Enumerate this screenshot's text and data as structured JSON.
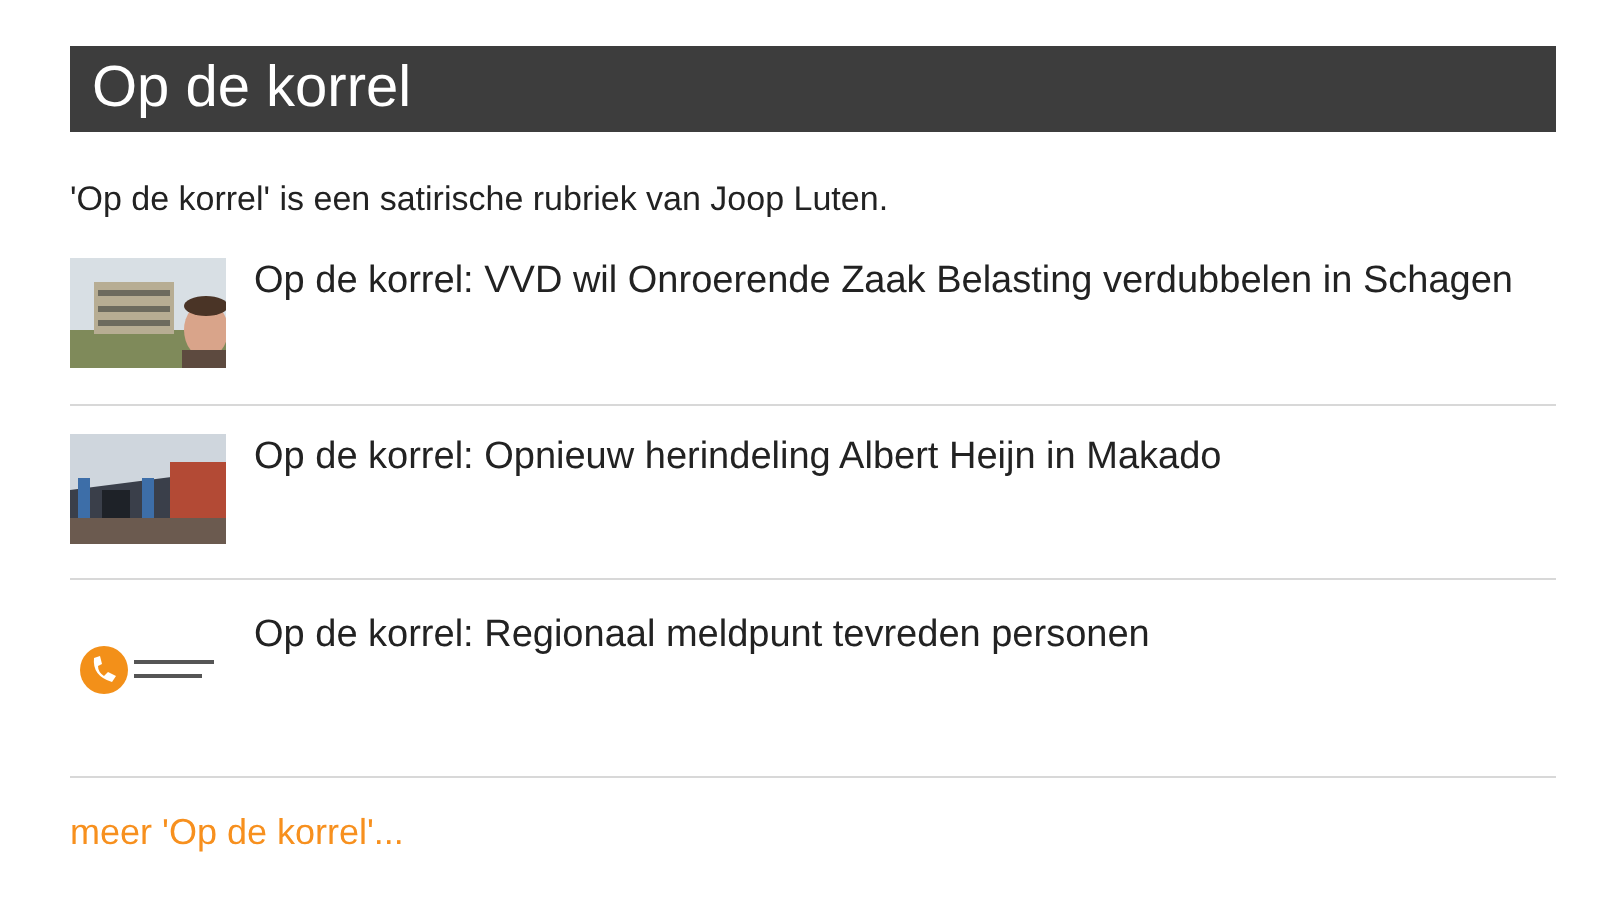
{
  "heading": "Op de korrel",
  "intro": "'Op de korrel' is een satirische rubriek van Joop Luten.",
  "articles": [
    {
      "title": "Op de korrel: VVD wil Onroerende Zaak Belasting verdubbelen in Schagen"
    },
    {
      "title": "Op de korrel: Opnieuw herindeling Albert Heijn in Makado"
    },
    {
      "title": "Op de korrel: Regionaal meldpunt tevreden personen"
    }
  ],
  "more_link": "meer 'Op de korrel'..."
}
